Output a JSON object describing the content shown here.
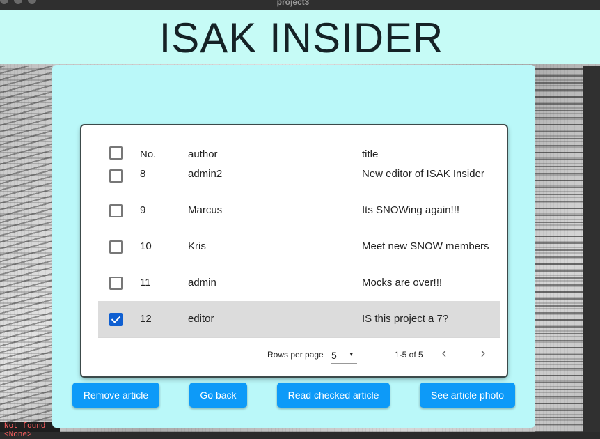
{
  "window": {
    "title": "project3"
  },
  "header": {
    "title": "ISAK INSIDER"
  },
  "table": {
    "columns": {
      "no": "No.",
      "author": "author",
      "title": "title"
    },
    "rows": [
      {
        "no": "8",
        "author": "admin2",
        "title": "New editor of ISAK Insider",
        "checked": false
      },
      {
        "no": "9",
        "author": "Marcus",
        "title": "Its SNOWing again!!!",
        "checked": false
      },
      {
        "no": "10",
        "author": "Kris",
        "title": "Meet new SNOW members",
        "checked": false
      },
      {
        "no": "11",
        "author": "admin",
        "title": "Mocks are over!!!",
        "checked": false
      },
      {
        "no": "12",
        "author": "editor",
        "title": "IS this project a 7?",
        "checked": true
      }
    ],
    "pagination": {
      "rows_per_page_label": "Rows per page",
      "rows_per_page_value": "5",
      "range": "1-5 of 5",
      "prev_icon": "chevron-left-icon",
      "next_icon": "chevron-right-icon"
    }
  },
  "buttons": {
    "remove": "Remove article",
    "back": "Go back",
    "read": "Read checked article",
    "photo": "See article photo"
  },
  "console": {
    "status_text": "Not found <None>"
  },
  "colors": {
    "header_bg": "#c6fbf6",
    "panel_bg": "#baf8f9",
    "button_bg": "#0d9af8",
    "checkbox_checked": "#0f5fd1",
    "selected_row": "#dcdcdc"
  }
}
